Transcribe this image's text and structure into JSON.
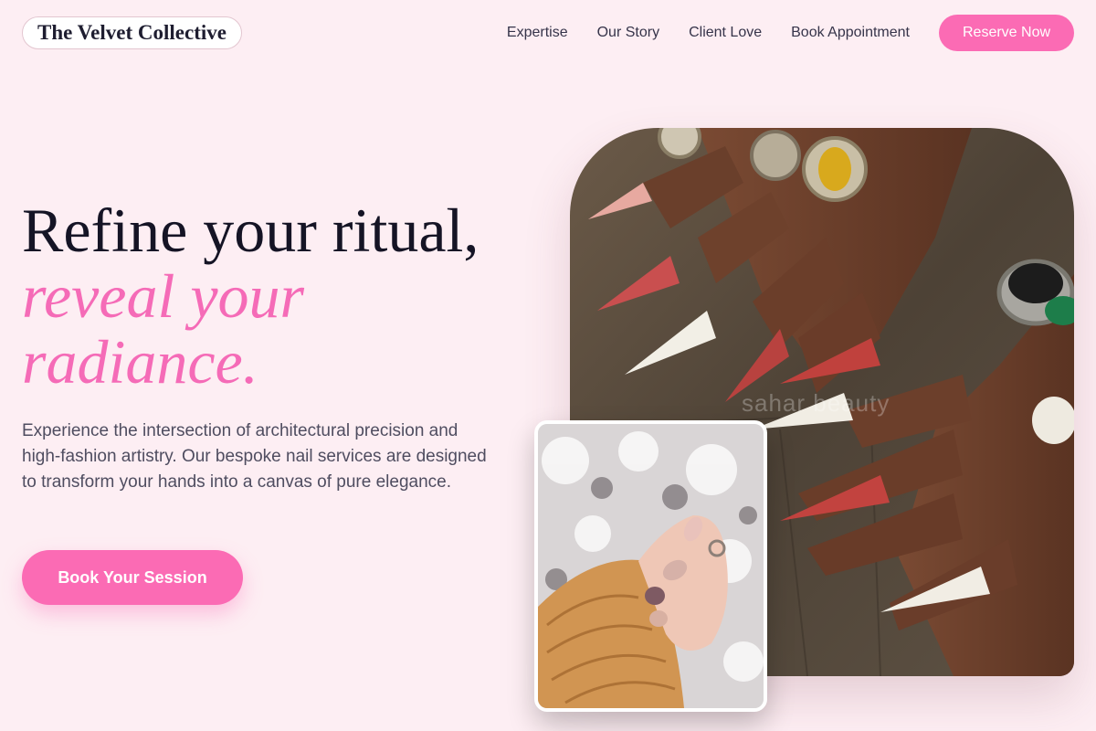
{
  "header": {
    "logo": "The Velvet Collective",
    "nav": [
      "Expertise",
      "Our Story",
      "Client Love",
      "Book Appointment"
    ],
    "cta": "Reserve Now"
  },
  "hero": {
    "title_line1": "Refine your ritual,",
    "title_accent": "reveal your radiance.",
    "description": "Experience the intersection of architectural precision and high-fashion artistry. Our bespoke nail services are designed to transform your hands into a canvas of pure elegance.",
    "button": "Book Your Session"
  },
  "images": {
    "main_watermark": "sahar beauty"
  },
  "colors": {
    "background": "#fdeef3",
    "accent": "#fb6bb4",
    "heading": "#151425",
    "body_text": "#4f4d60"
  }
}
